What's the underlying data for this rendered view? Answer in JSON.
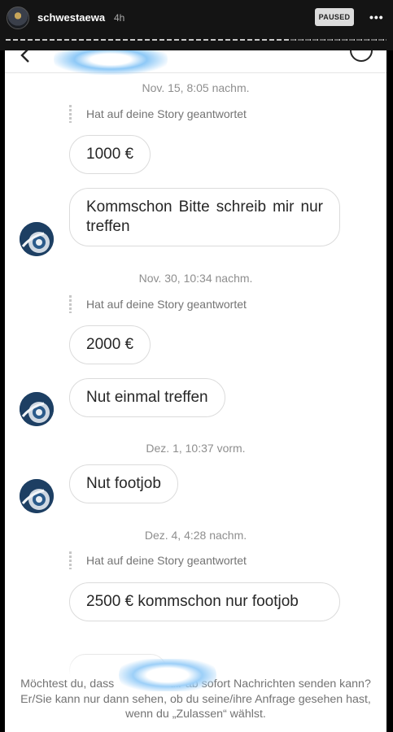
{
  "story": {
    "username": "schwestaewa",
    "time_ago": "4h",
    "status_badge": "PAUSED",
    "more_icon": "ellipsis-icon"
  },
  "chat": {
    "header": {
      "back_icon": "chevron-left-icon",
      "info_icon": "info-icon",
      "name_redacted": true
    },
    "items": [
      {
        "type": "timestamp",
        "text": "Nov. 15, 8:05 nachm."
      },
      {
        "type": "reply_note",
        "text": "Hat auf deine Story geantwortet"
      },
      {
        "type": "message",
        "text": "1000 €"
      },
      {
        "type": "message",
        "text": "Kommschon Bitte schreib mir nur treffen",
        "avatar": true
      },
      {
        "type": "timestamp",
        "text": "Nov. 30, 10:34 nachm."
      },
      {
        "type": "reply_note",
        "text": "Hat auf deine Story geantwortet"
      },
      {
        "type": "message",
        "text": "2000 €"
      },
      {
        "type": "message",
        "text": "Nut einmal treffen",
        "avatar": true
      },
      {
        "type": "timestamp",
        "text": "Dez. 1, 10:37 vorm."
      },
      {
        "type": "message",
        "text": "Nut footjob",
        "avatar": true
      },
      {
        "type": "timestamp",
        "text": "Dez. 4, 4:28 nachm."
      },
      {
        "type": "reply_note",
        "text": "Hat auf deine Story geantwortet"
      },
      {
        "type": "message",
        "text": "2500 € kommschon  nur footjob"
      }
    ],
    "request_text_1": "Möchtest du, dass",
    "request_text_2": "dir ab sofort Nachrichten senden kann? Er/Sie kann",
    "request_text_3": "nur",
    "request_text_4": "dann sehen, ob du seine/ihre Anfrage gesehen hast, wenn du „Zulassen“ wählst."
  }
}
